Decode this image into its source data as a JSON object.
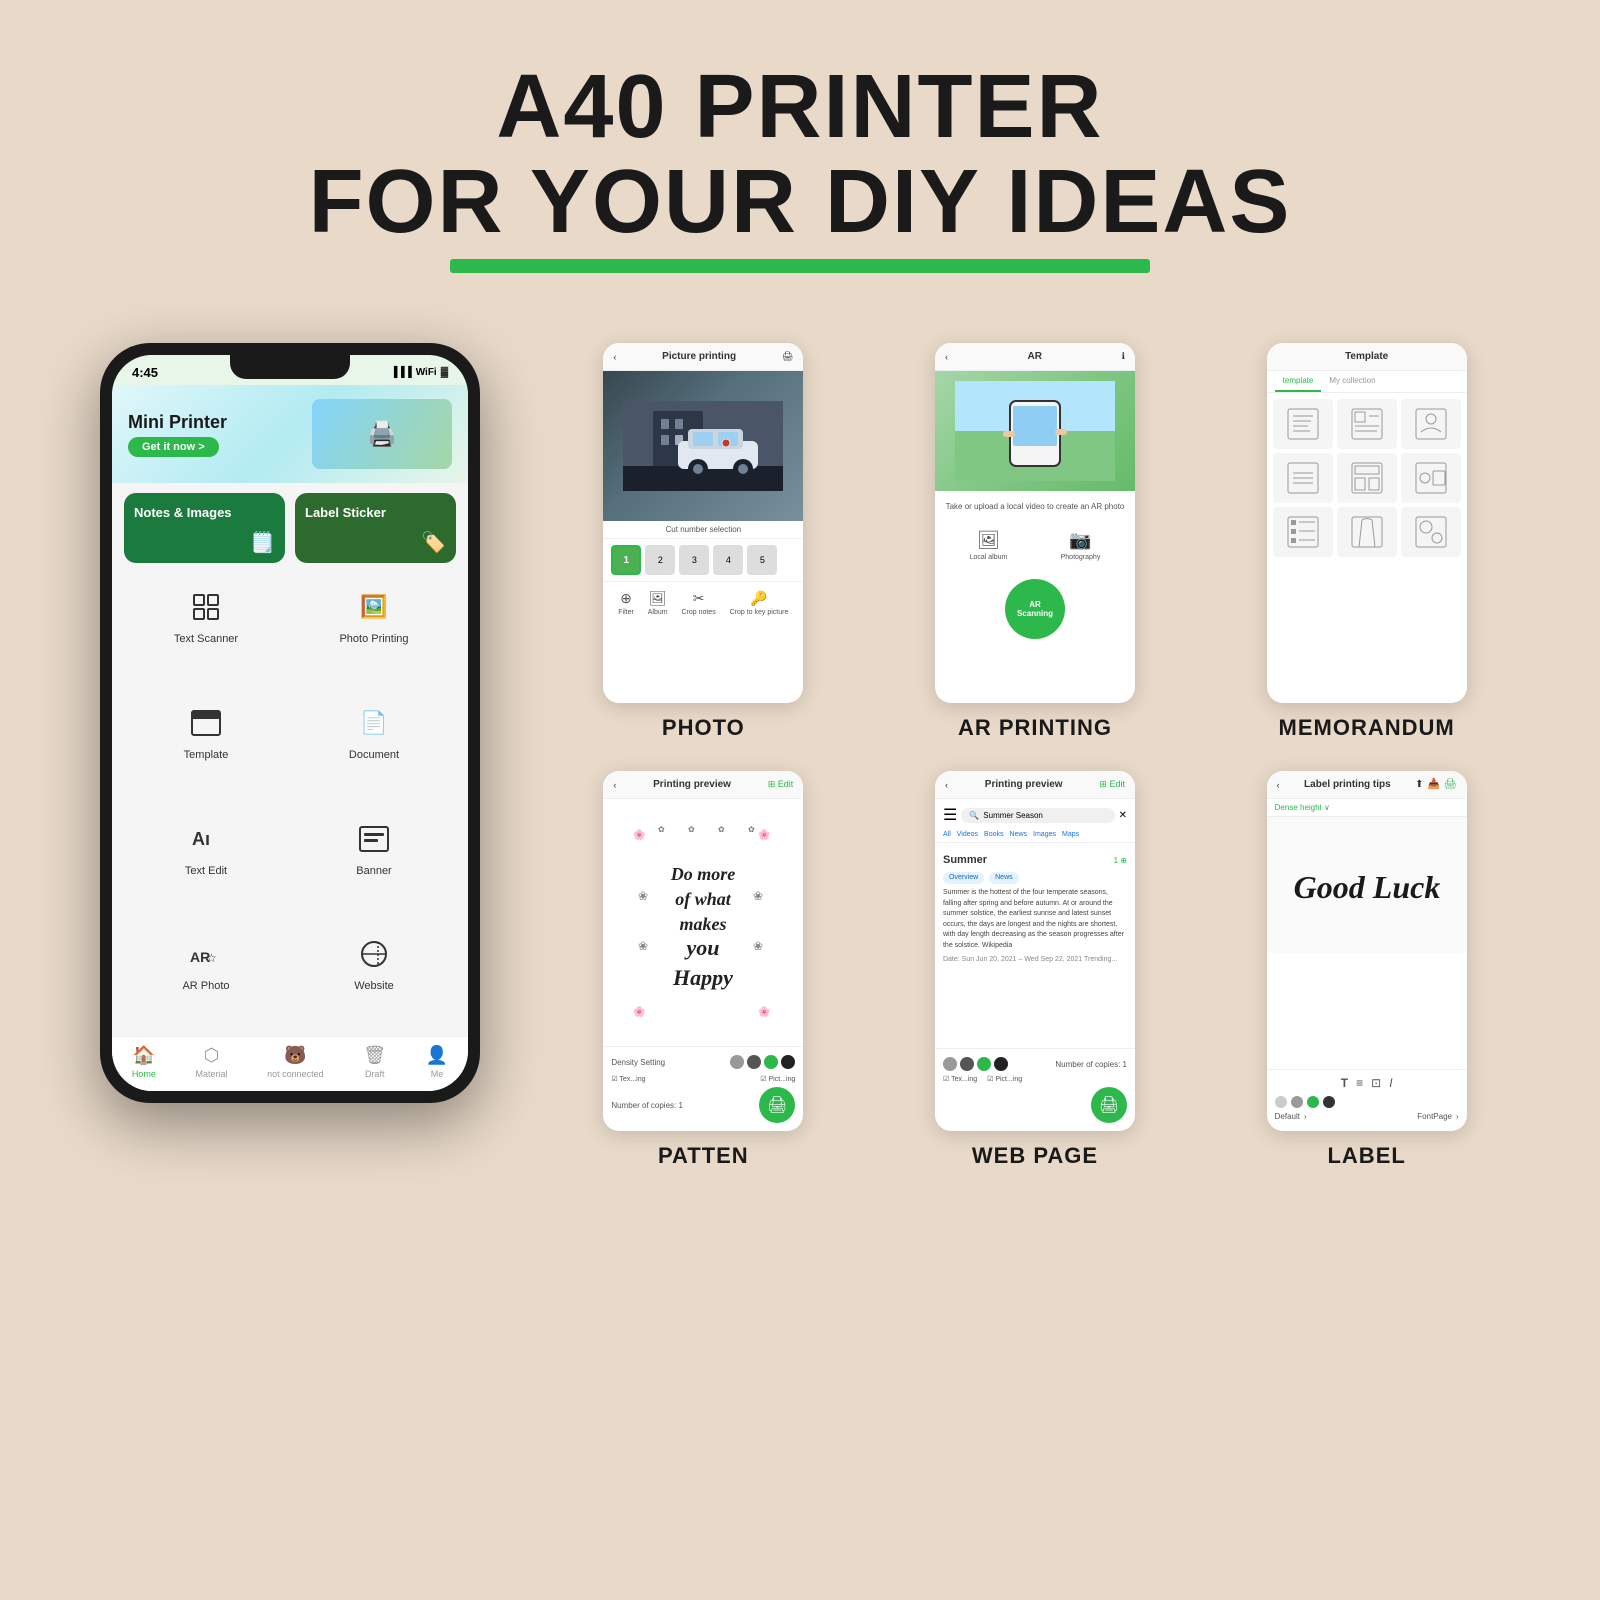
{
  "header": {
    "line1": "A40 PRINTER",
    "line2": "FOR YOUR DIY IDEAS"
  },
  "phone": {
    "status_time": "4:45",
    "banner": {
      "title": "Mini Printer",
      "button": "Get it now >"
    },
    "quick_actions": [
      {
        "label": "Notes & Images",
        "icon": "🗒️"
      },
      {
        "label": "Label Sticker",
        "icon": "🏷️"
      }
    ],
    "app_icons": [
      {
        "label": "Text Scanner",
        "icon": "⊞"
      },
      {
        "label": "Photo Printing",
        "icon": "🖼"
      },
      {
        "label": "Template",
        "icon": "▭"
      },
      {
        "label": "Document",
        "icon": "📄"
      },
      {
        "label": "Text Edit",
        "icon": "Aı"
      },
      {
        "label": "Banner",
        "icon": "⊡"
      },
      {
        "label": "AR Photo",
        "icon": "AR"
      },
      {
        "label": "Website",
        "icon": "⊘"
      }
    ],
    "nav": [
      {
        "label": "Home",
        "icon": "🏠",
        "active": true
      },
      {
        "label": "Material",
        "icon": "⬡",
        "active": false
      },
      {
        "label": "not connected",
        "icon": "🐻",
        "active": false
      },
      {
        "label": "Draft",
        "icon": "🗑",
        "active": false
      },
      {
        "label": "Me",
        "icon": "👤",
        "active": false
      }
    ]
  },
  "screenshots": [
    {
      "id": "photo",
      "header_title": "Picture printing",
      "label": "PHOTO"
    },
    {
      "id": "ar",
      "header_title": "AR",
      "label": "AR PRINTING"
    },
    {
      "id": "memo",
      "header_title": "Template",
      "tab2": "My collection",
      "label": "MEMORANDUM"
    },
    {
      "id": "pattern",
      "header_title": "Printing preview",
      "pattern_text": "Do more\nof what\nmakes\nyou\nHappy",
      "label": "PATTEN"
    },
    {
      "id": "webpage",
      "header_title": "Printing preview",
      "search_query": "Summer Season",
      "web_title": "Summer",
      "web_text": "Summer is the hottest of the four temperate seasons, falling after spring and before autumn. At or around the summer solstice, the earliest sunrise and latest sunset occurs, the days are longest and the nights are shortest, with day length decreasing as the season progresses after the solstice. Wikipedia",
      "label": "WEB PAGE"
    },
    {
      "id": "label",
      "header_title": "Label printing tips",
      "label_text": "Good Luck",
      "font_name1": "Default",
      "font_name2": "FontPage",
      "label": "LABEL"
    }
  ]
}
